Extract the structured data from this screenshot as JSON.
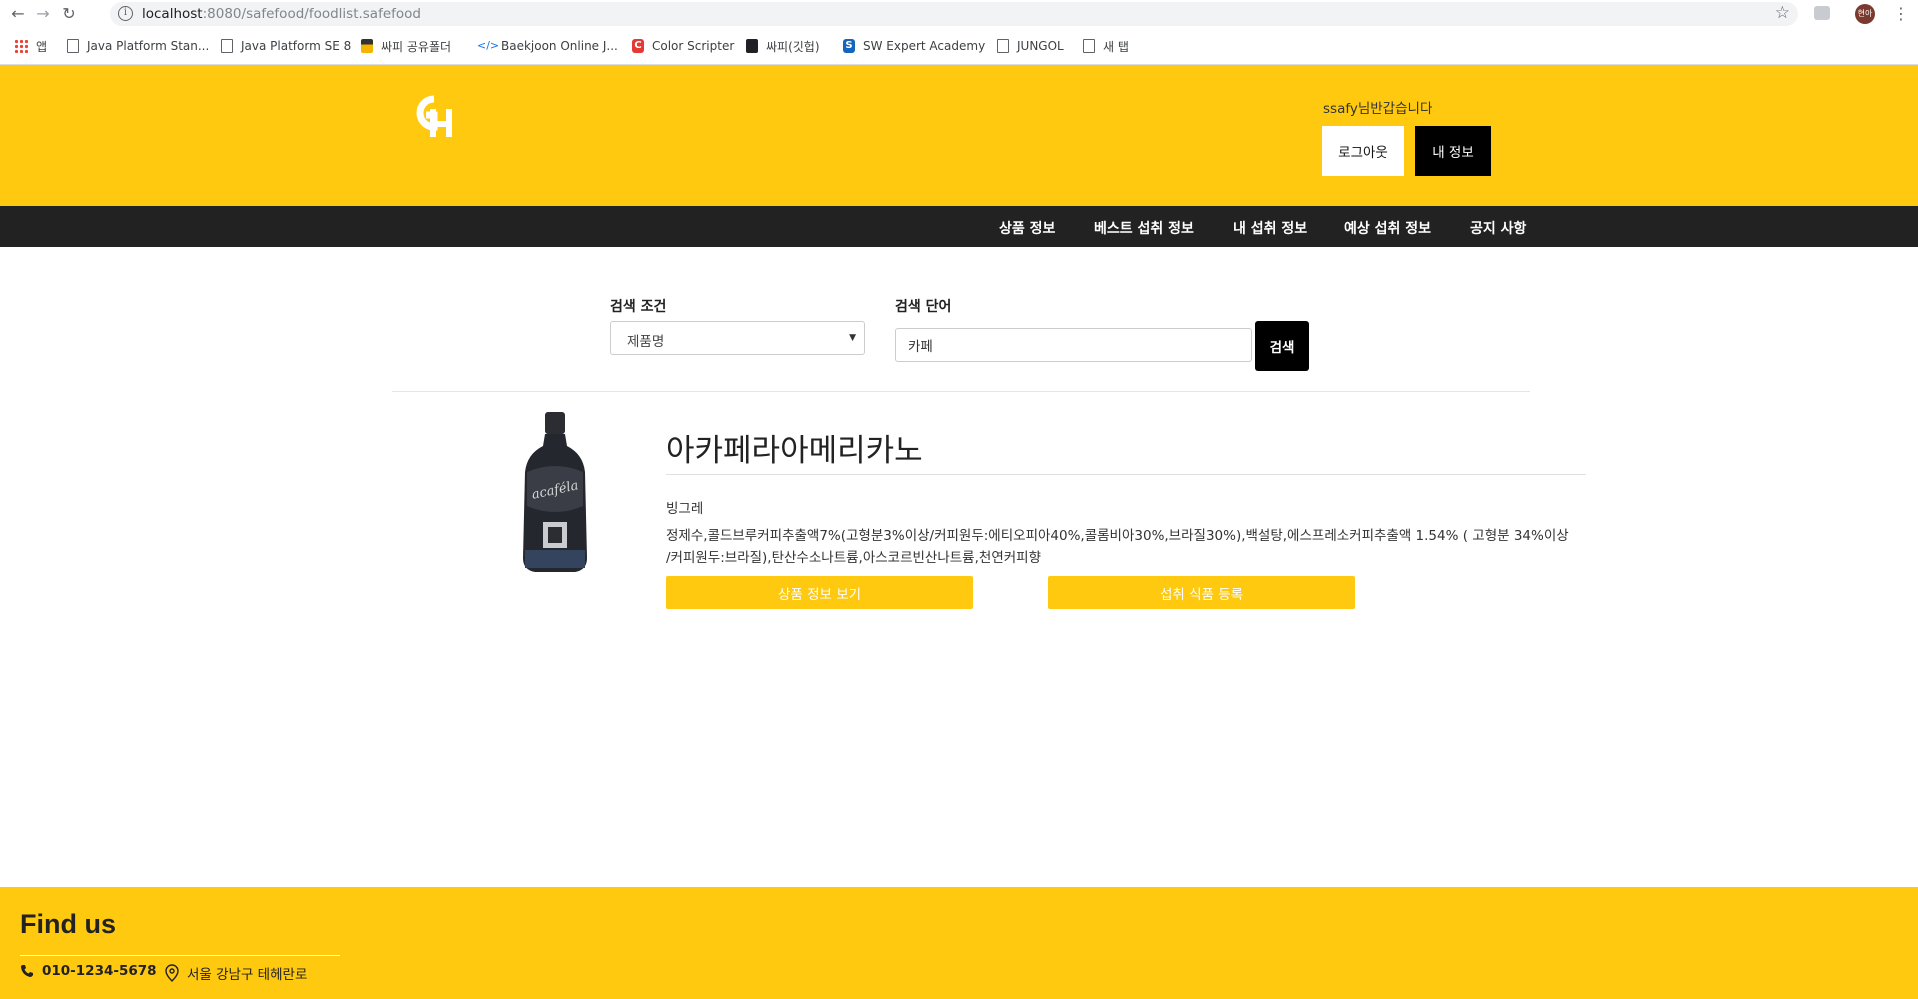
{
  "browser": {
    "url_host": "localhost",
    "url_rest": ":8080/safefood/foodlist.safefood",
    "profile_label": "현아",
    "bookmarks": [
      {
        "label": "앱",
        "icon": "apps-grid-icon"
      },
      {
        "label": "Java Platform Stan...",
        "icon": "page-icon"
      },
      {
        "label": "Java Platform SE 8",
        "icon": "page-icon"
      },
      {
        "label": "싸피 공유폴더",
        "icon": "share-folder-icon"
      },
      {
        "label": "Baekjoon Online J...",
        "icon": "code-icon"
      },
      {
        "label": "Color Scripter",
        "icon": "color-scripter-icon"
      },
      {
        "label": "싸피(깃헙)",
        "icon": "github-icon"
      },
      {
        "label": "SW Expert Academy",
        "icon": "swea-icon"
      },
      {
        "label": "JUNGOL",
        "icon": "page-icon"
      },
      {
        "label": "새 탭",
        "icon": "page-icon"
      }
    ]
  },
  "header": {
    "welcome": "ssafy님반갑습니다",
    "logout_label": "로그아웃",
    "myinfo_label": "내 정보",
    "brand_color": "#fec90f"
  },
  "nav": {
    "items": [
      "상품 정보",
      "베스트 섭취 정보",
      "내 섭취 정보",
      "예상 섭취 정보",
      "공지 사항"
    ]
  },
  "search": {
    "condition_label": "검색 조건",
    "condition_value": "제품명",
    "term_label": "검색 단어",
    "term_value": "카페",
    "button_label": "검색"
  },
  "product": {
    "name": "아카페라아메리카노",
    "maker": "빙그레",
    "ingredients": "정제수,콜드브루커피추출액7%(고형분3%이상/커피원두:에티오피아40%,콜롬비아30%,브라질30%),백설탕,에스프레소커피추출액 1.54% ( 고형분 34%이상 /커피원두:브라질),탄산수소나트륨,아스코르빈산나트륨,천연커피향",
    "view_button": "상품 정보 보기",
    "add_button": "섭취 식품 등록"
  },
  "footer": {
    "title": "Find us",
    "phone": "010-1234-5678",
    "address": "서울 강남구 테헤란로"
  }
}
